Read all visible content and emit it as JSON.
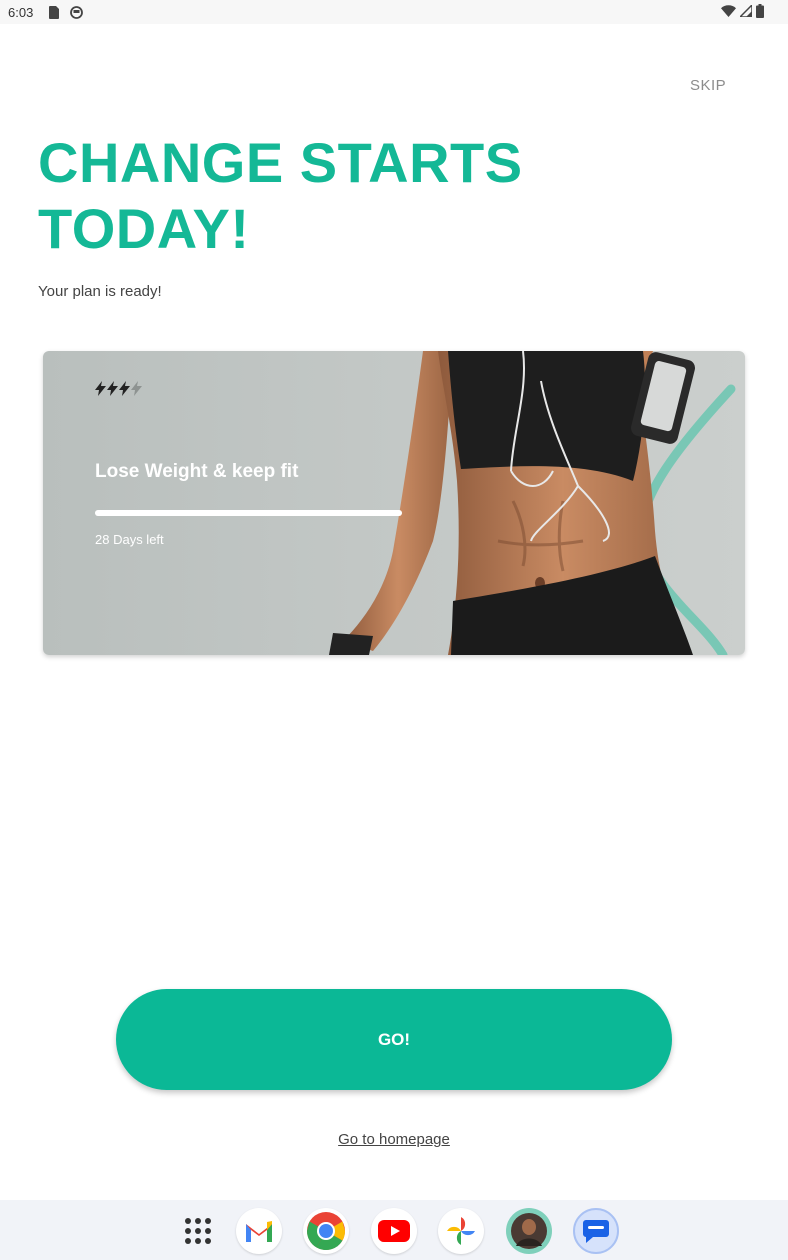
{
  "status_bar": {
    "time": "6:03"
  },
  "header": {
    "skip_label": "SKIP"
  },
  "hero": {
    "headline_line1": "CHANGE STARTS",
    "headline_line2": "TODAY!",
    "subtitle": "Your plan is ready!"
  },
  "plan_card": {
    "title": "Lose Weight & keep fit",
    "days_left": "28 Days left",
    "intensity_level": 3,
    "intensity_max": 4,
    "progress_fraction": 1.0
  },
  "actions": {
    "go_label": "GO!",
    "homepage_label": "Go to homepage"
  },
  "dock": {
    "apps": [
      "app-drawer",
      "gmail",
      "chrome",
      "youtube",
      "photos",
      "fitness-app",
      "messages"
    ]
  },
  "colors": {
    "accent": "#14b896",
    "button": "#0bb896",
    "card_bg": "#c2c7c5",
    "text_muted": "#8c8c8c"
  }
}
